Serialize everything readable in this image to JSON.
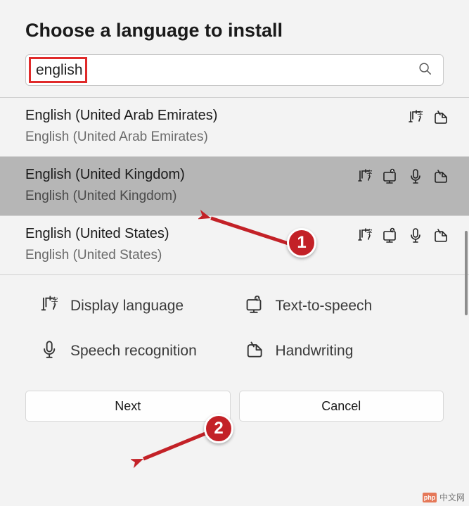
{
  "dialog": {
    "title": "Choose a language to install"
  },
  "search": {
    "value": "english"
  },
  "languages": [
    {
      "name": "English (United Arab Emirates)",
      "native": "English (United Arab Emirates)",
      "features": {
        "display": true,
        "tts": false,
        "speech": false,
        "handwriting": true
      },
      "selected": false
    },
    {
      "name": "English (United Kingdom)",
      "native": "English (United Kingdom)",
      "features": {
        "display": true,
        "tts": true,
        "speech": true,
        "handwriting": true
      },
      "selected": true
    },
    {
      "name": "English (United States)",
      "native": "English (United States)",
      "features": {
        "display": true,
        "tts": true,
        "speech": true,
        "handwriting": true
      },
      "selected": false
    }
  ],
  "legend": {
    "display": "Display language",
    "tts": "Text-to-speech",
    "speech": "Speech recognition",
    "handwriting": "Handwriting"
  },
  "buttons": {
    "next": "Next",
    "cancel": "Cancel"
  },
  "annotations": {
    "callout1": "1",
    "callout2": "2"
  },
  "watermark": {
    "logo": "php",
    "text": "中文网"
  }
}
